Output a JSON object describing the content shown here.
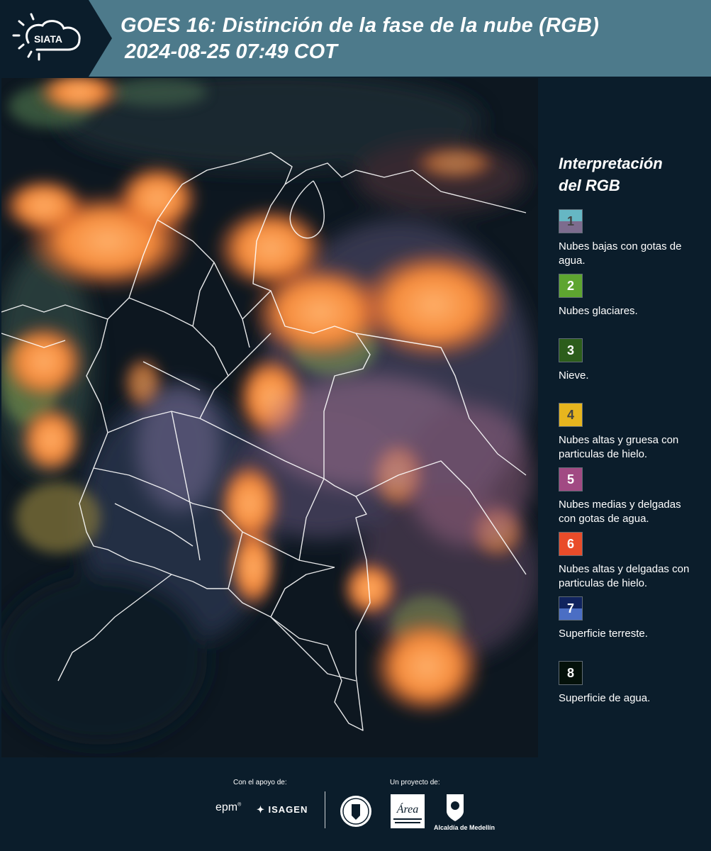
{
  "header": {
    "logo_text": "SIATA",
    "title": "GOES 16: Distinción de la fase de la nube (RGB)",
    "subtitle": "2024-08-25 07:49 COT",
    "background": "#4d7a8b"
  },
  "legend": {
    "title": "Interpretación\ndel RGB",
    "items": [
      {
        "number": "1",
        "label": "Nubes bajas con gotas de agua.",
        "color_top": "#66b7c4",
        "color_bottom": "#7d6c8e",
        "num_color": "#444444"
      },
      {
        "number": "2",
        "label": "Nubes glaciares.",
        "color_top": "#5ea530",
        "color_bottom": "#5ea530",
        "num_color": "#ffffff"
      },
      {
        "number": "3",
        "label": "Nieve.",
        "color_top": "#2c5d1b",
        "color_bottom": "#2c5d1b",
        "num_color": "#ffffff"
      },
      {
        "number": "4",
        "label": "Nubes altas y gruesa con particulas de hielo.",
        "color_top": "#e7b51e",
        "color_bottom": "#e7b51e",
        "num_color": "#444444"
      },
      {
        "number": "5",
        "label": "Nubes medias y delgadas con gotas de agua.",
        "color_top": "#a14a83",
        "color_bottom": "#a14a83",
        "num_color": "#ffffff"
      },
      {
        "number": "6",
        "label": "Nubes altas y delgadas con particulas de hielo.",
        "color_top": "#e94c2a",
        "color_bottom": "#e94c2a",
        "num_color": "#ffffff"
      },
      {
        "number": "7",
        "label": "Superficie terreste.",
        "color_top": "#10235e",
        "color_bottom": "#4b6ec4",
        "num_color": "#ffffff"
      },
      {
        "number": "8",
        "label": "Superficie de agua.",
        "color_top": "#04110a",
        "color_bottom": "#04110a",
        "num_color": "#ffffff"
      }
    ]
  },
  "footer": {
    "support_label": "Con el apoyo de:",
    "project_label": "Un proyecto de:",
    "epm_logo": "epm",
    "isagen_logo": "ISAGEN",
    "area_logo_text": "Área",
    "alcaldia_label": "Alcaldía de Medellín"
  }
}
